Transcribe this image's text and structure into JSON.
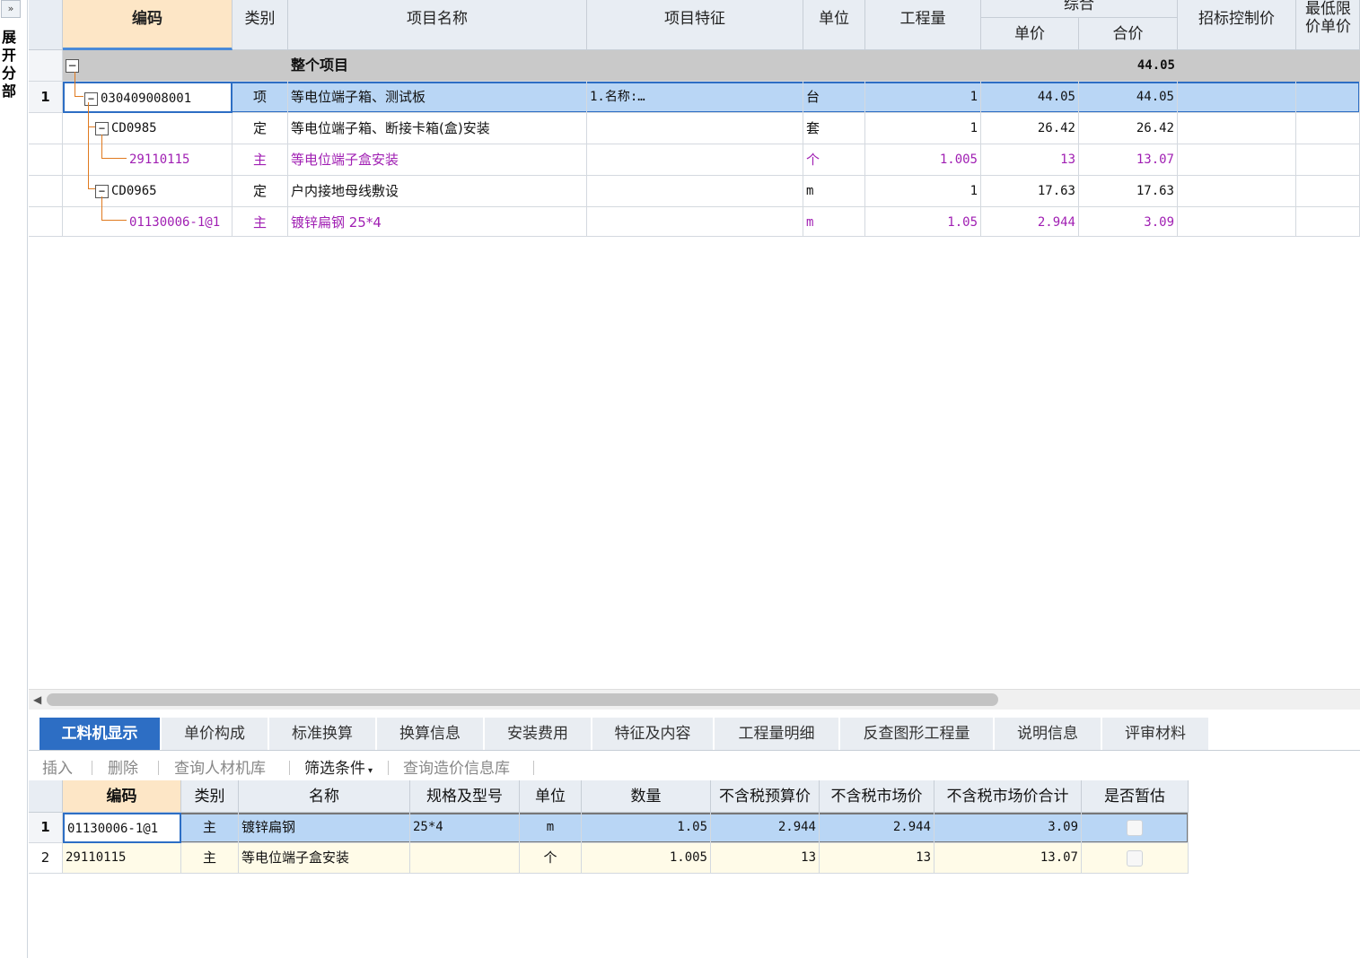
{
  "sidebar": {
    "expand_symbol": "»",
    "expand_label": "展开分部"
  },
  "grid": {
    "headers": {
      "code": "编码",
      "type": "类别",
      "name": "项目名称",
      "feature": "项目特征",
      "unit": "单位",
      "quantity": "工程量",
      "composite": "综合",
      "unit_price": "单价",
      "total_price": "合价",
      "control_price": "招标控制价",
      "min_limit": "最低限价单价"
    },
    "summary_row": {
      "label": "整个项目",
      "total": "44.05"
    },
    "rows": [
      {
        "rownum": "1",
        "code": "030409008001",
        "type": "项",
        "name": "等电位端子箱、测试板",
        "feature": "1.名称:…",
        "unit": "台",
        "quantity": "1",
        "unit_price": "44.05",
        "total_price": "44.05"
      },
      {
        "rownum": "",
        "code": "CD0985",
        "type": "定",
        "name": "等电位端子箱、断接卡箱(盒)安装",
        "feature": "",
        "unit": "套",
        "quantity": "1",
        "unit_price": "26.42",
        "total_price": "26.42"
      },
      {
        "rownum": "",
        "code": "29110115",
        "type": "主",
        "name": "等电位端子盒安装",
        "feature": "",
        "unit": "个",
        "quantity": "1.005",
        "unit_price": "13",
        "total_price": "13.07"
      },
      {
        "rownum": "",
        "code": "CD0965",
        "type": "定",
        "name": "户内接地母线敷设",
        "feature": "",
        "unit": "m",
        "quantity": "1",
        "unit_price": "17.63",
        "total_price": "17.63"
      },
      {
        "rownum": "",
        "code": "01130006-1@1",
        "type": "主",
        "name": "镀锌扁钢 25*4",
        "feature": "",
        "unit": "m",
        "quantity": "1.05",
        "unit_price": "2.944",
        "total_price": "3.09"
      }
    ]
  },
  "tabs": [
    "工料机显示",
    "单价构成",
    "标准换算",
    "换算信息",
    "安装费用",
    "特征及内容",
    "工程量明细",
    "反查图形工程量",
    "说明信息",
    "评审材料"
  ],
  "toolbar": {
    "insert": "插入",
    "delete": "删除",
    "query_lib": "查询人材机库",
    "filter": "筛选条件",
    "query_price": "查询造价信息库"
  },
  "lower_grid": {
    "headers": {
      "code": "编码",
      "type": "类别",
      "name": "名称",
      "spec": "规格及型号",
      "unit": "单位",
      "qty": "数量",
      "budget_price": "不含税预算价",
      "market_price": "不含税市场价",
      "market_total": "不含税市场价合计",
      "provisional": "是否暂估"
    },
    "rows": [
      {
        "rownum": "1",
        "code": "01130006-1@1",
        "type": "主",
        "name": "镀锌扁钢",
        "spec": "25*4",
        "unit": "m",
        "qty": "1.05",
        "budget_price": "2.944",
        "market_price": "2.944",
        "market_total": "3.09"
      },
      {
        "rownum": "2",
        "code": "29110115",
        "type": "主",
        "name": "等电位端子盒安装",
        "spec": "",
        "unit": "个",
        "qty": "1.005",
        "budget_price": "13",
        "market_price": "13",
        "market_total": "13.07"
      }
    ]
  },
  "colors": {
    "accent": "#2d6ec4",
    "selected_row": "#b9d6f5",
    "main_material": "#a01fb3",
    "tree_line": "#e07a1f",
    "header_selected": "#fde6c6"
  }
}
